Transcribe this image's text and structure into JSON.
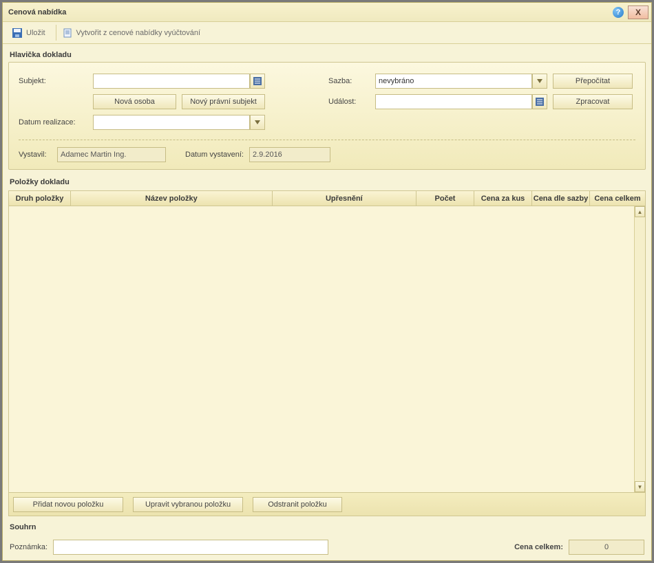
{
  "window": {
    "title": "Cenová nabídka"
  },
  "toolbar": {
    "save_label": "Uložit",
    "create_invoice_label": "Vytvořit z cenové nabídky vyúčtování"
  },
  "header": {
    "section_title": "Hlavička dokladu",
    "subject_label": "Subjekt:",
    "subject_value": "",
    "new_person_btn": "Nová osoba",
    "new_legal_btn": "Nový právní subjekt",
    "rate_label": "Sazba:",
    "rate_value": "nevybráno",
    "recalc_btn": "Přepočítat",
    "event_label": "Událost:",
    "event_value": "",
    "process_btn": "Zpracovat",
    "realization_label": "Datum realizace:",
    "realization_value": "",
    "issuer_label": "Vystavil:",
    "issuer_value": "Adamec Martin Ing.",
    "issue_date_label": "Datum vystavení:",
    "issue_date_value": "2.9.2016"
  },
  "items": {
    "section_title": "Položky dokladu",
    "columns": {
      "druh": "Druh položky",
      "nazev": "Název položky",
      "upresneni": "Upřesnění",
      "pocet": "Počet",
      "kus": "Cena za kus",
      "sazba": "Cena dle sazby",
      "celkem": "Cena celkem"
    },
    "rows": [],
    "add_btn": "Přidat novou položku",
    "edit_btn": "Upravit vybranou položku",
    "delete_btn": "Odstranit položku"
  },
  "summary": {
    "section_title": "Souhrn",
    "note_label": "Poznámka:",
    "note_value": "",
    "total_label": "Cena celkem:",
    "total_value": "0"
  }
}
